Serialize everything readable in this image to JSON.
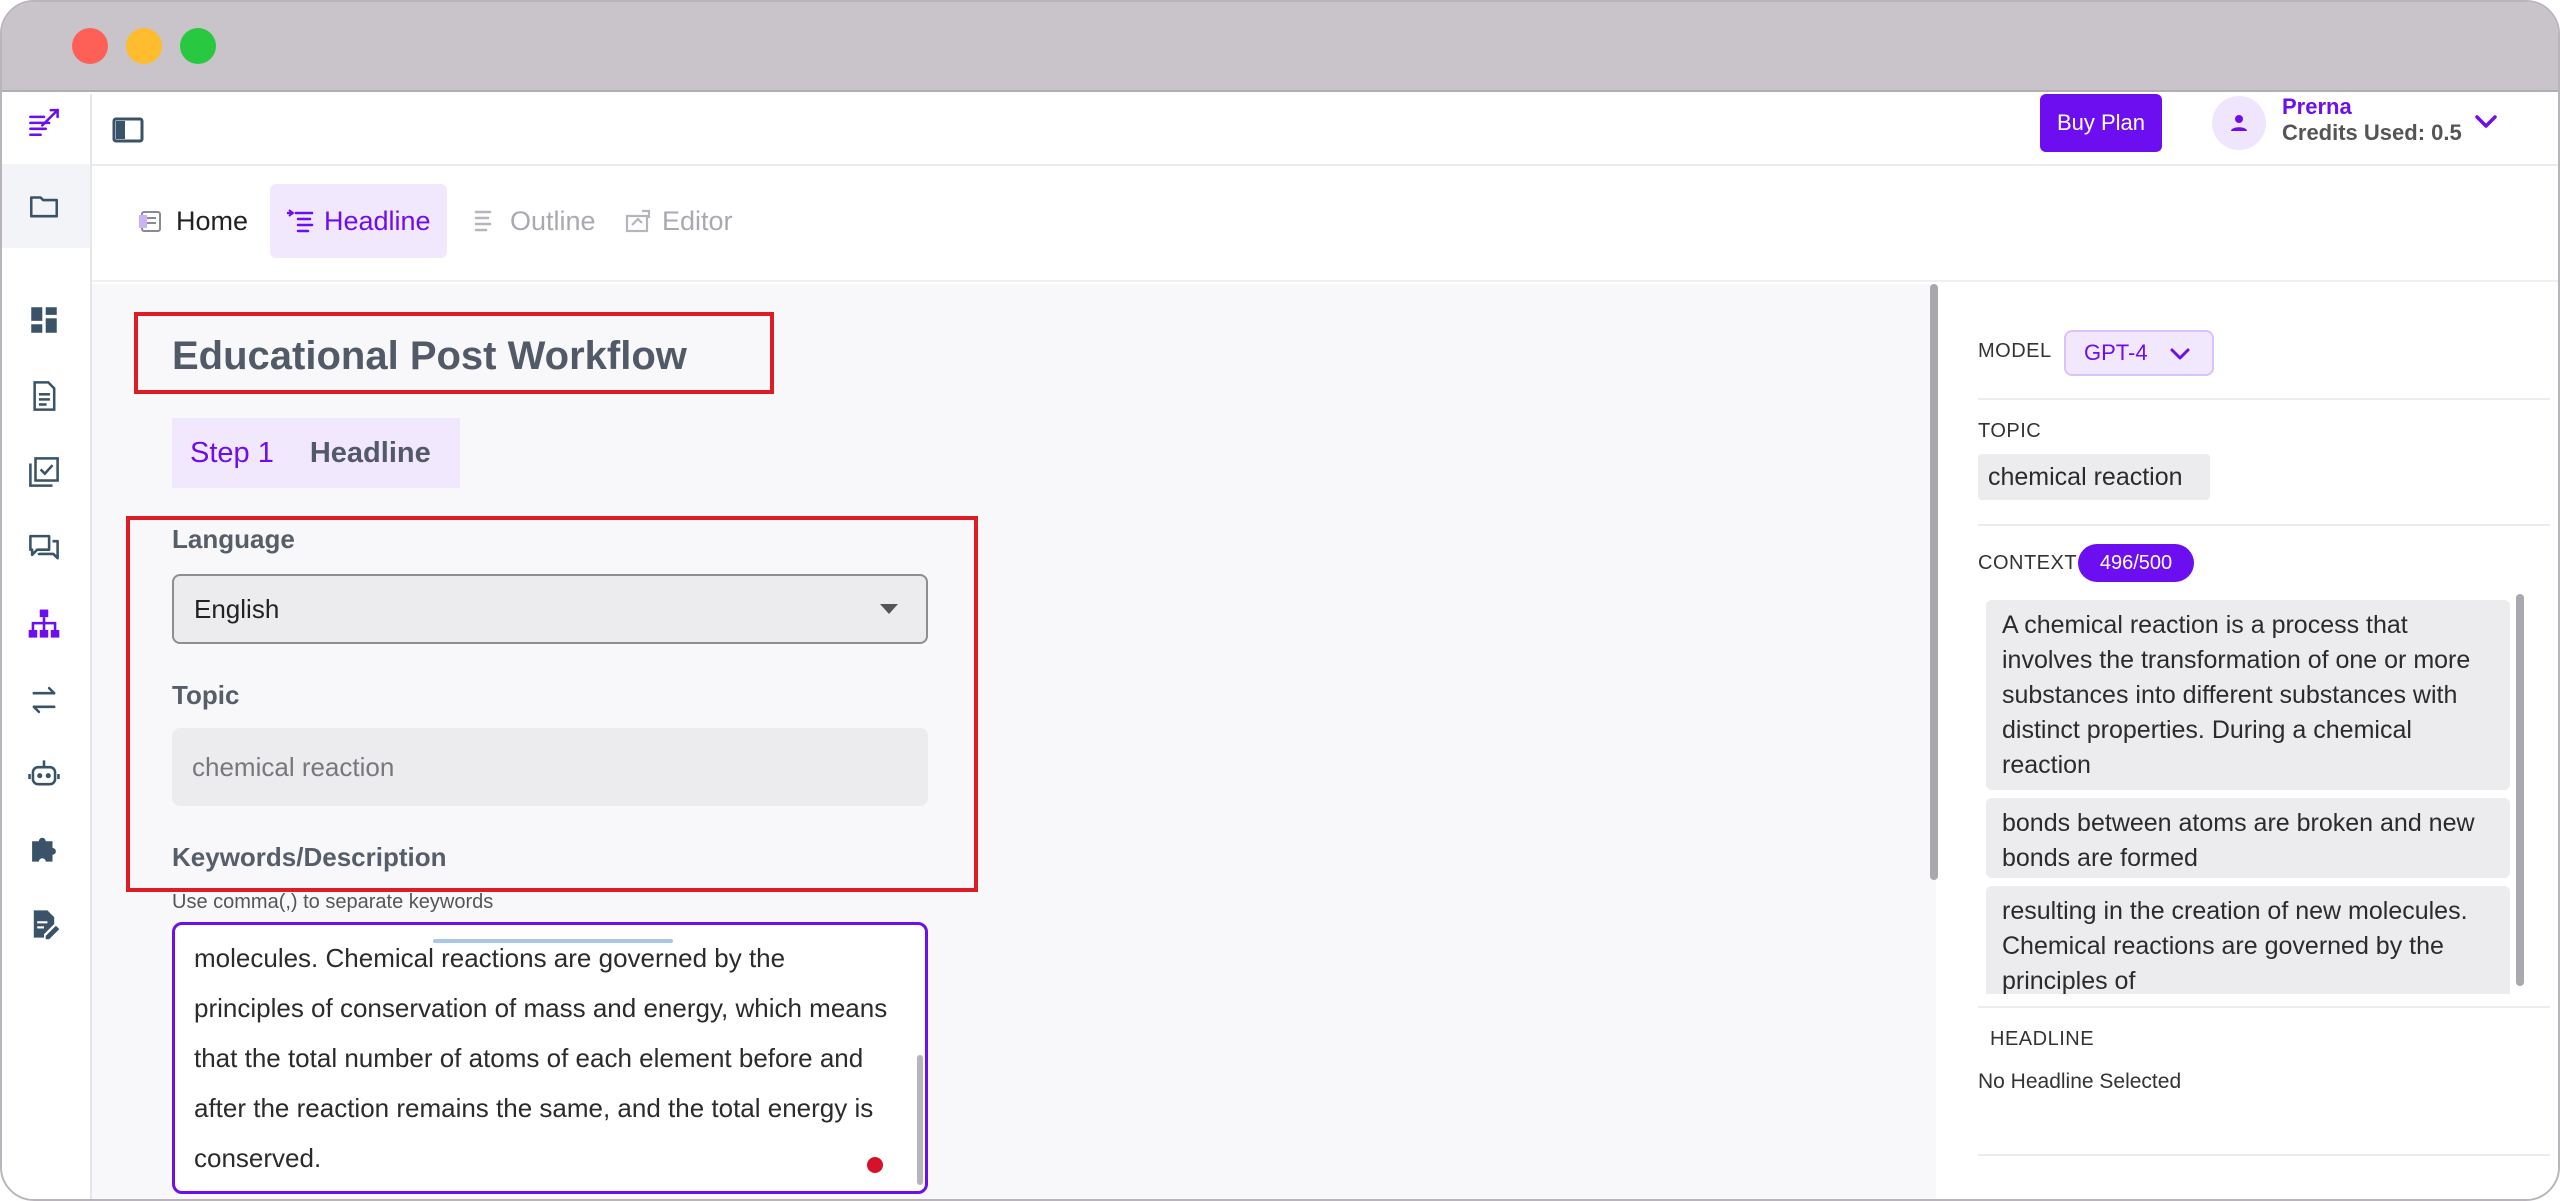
{
  "brand": {
    "accent": "#6d0ef0",
    "highlight": "#dd1d26"
  },
  "sidebar": {
    "items": [
      {
        "icon": "quill-logo-icon"
      },
      {
        "icon": "folder-icon"
      },
      {
        "icon": "dashboard-icon"
      },
      {
        "icon": "document-icon"
      },
      {
        "icon": "checklist-icon"
      },
      {
        "icon": "chat-icon"
      },
      {
        "icon": "workflow-tree-icon"
      },
      {
        "icon": "swap-icon"
      },
      {
        "icon": "robot-icon"
      },
      {
        "icon": "puzzle-icon"
      },
      {
        "icon": "edit-document-icon"
      }
    ]
  },
  "header": {
    "buy_plan_label": "Buy Plan",
    "user_name": "Prerna",
    "credits_used": "Credits Used: 0.5"
  },
  "tabs": [
    {
      "label": "Home",
      "state": "normal",
      "icon": "home-icon"
    },
    {
      "label": "Headline",
      "state": "active",
      "icon": "headline-icon"
    },
    {
      "label": "Outline",
      "state": "disabled",
      "icon": "outline-icon"
    },
    {
      "label": "Editor",
      "state": "disabled",
      "icon": "editor-icon"
    }
  ],
  "main": {
    "title": "Educational Post Workflow",
    "step": {
      "number": "Step 1",
      "label": "Headline"
    },
    "language": {
      "label": "Language",
      "value": "English"
    },
    "topic": {
      "label": "Topic",
      "value": "chemical reaction"
    },
    "keywords": {
      "label": "Keywords/Description",
      "helper": "Use comma(,) to separate keywords",
      "value": "molecules. Chemical reactions are governed by the principles of conservation of mass and energy, which means that the total number of atoms of each element before and after the reaction remains the same, and the total energy is conserved."
    }
  },
  "panel": {
    "model": {
      "label": "MODEL",
      "value": "GPT-4"
    },
    "topic": {
      "label": "TOPIC",
      "value": "chemical reaction"
    },
    "context": {
      "label": "CONTEXT",
      "count": "496/500",
      "chunks": [
        "A chemical reaction is a process that involves the transformation of one or more substances into different substances with distinct properties. During a chemical reaction",
        "bonds between atoms are broken and new bonds are formed",
        "resulting in the creation of new molecules. Chemical reactions are governed by the principles of"
      ]
    },
    "headline": {
      "label": "HEADLINE",
      "empty_text": "No Headline Selected"
    }
  }
}
